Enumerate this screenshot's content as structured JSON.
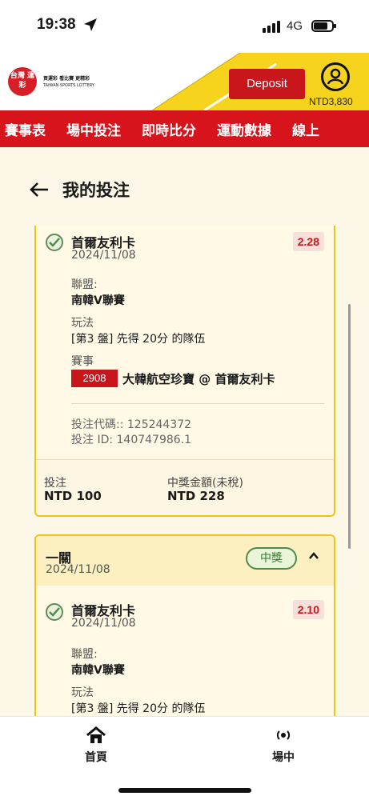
{
  "status_bar": {
    "time": "19:38",
    "network": "4G"
  },
  "header": {
    "logo_text": "台灣 運彩",
    "logo_tagline": "買運彩 看比賽 更精彩",
    "logo_sub": "TAIWAN SPORTS LOTTERY",
    "deposit_label": "Deposit",
    "balance": "NTD3,830",
    "brand_color": "#d7141c",
    "accent_color": "#f0c417"
  },
  "nav": {
    "items": [
      {
        "label": "賽事表"
      },
      {
        "label": "場中投注"
      },
      {
        "label": "即時比分"
      },
      {
        "label": "運動數據"
      },
      {
        "label": "線上"
      }
    ]
  },
  "page": {
    "back_icon": "back-arrow-icon",
    "title": "我的投注"
  },
  "bets": [
    {
      "selection": {
        "team": "首爾友利卡",
        "date": "2024/11/08",
        "odds": "2.28"
      },
      "league_label": "聯盟:",
      "league": "南韓V聯賽",
      "market_label": "玩法",
      "market": "[第3 盤] 先得 20分 的隊伍",
      "event_label": "賽事",
      "event_code": "2908",
      "event_name": "大韓航空珍寶 @ 首爾友利卡",
      "bet_code": "投注代碼:: 125244372",
      "bet_id": "投注 ID: 140747986.1",
      "stake_label": "投注",
      "stake": "NTD 100",
      "payout_label": "中獎金額(未稅)",
      "payout": "NTD 228"
    },
    {
      "group_title": "一關",
      "group_date": "2024/11/08",
      "status": "中獎",
      "selection": {
        "team": "首爾友利卡",
        "date": "2024/11/08",
        "odds": "2.10"
      },
      "league_label": "聯盟:",
      "league": "南韓V聯賽",
      "market_label": "玩法",
      "market": "[第3 盤] 先得 20分 的隊伍"
    }
  ],
  "bottom_nav": [
    {
      "label": "首頁",
      "icon": "home-icon"
    },
    {
      "label": "場中",
      "icon": "live-broadcast-icon"
    }
  ]
}
